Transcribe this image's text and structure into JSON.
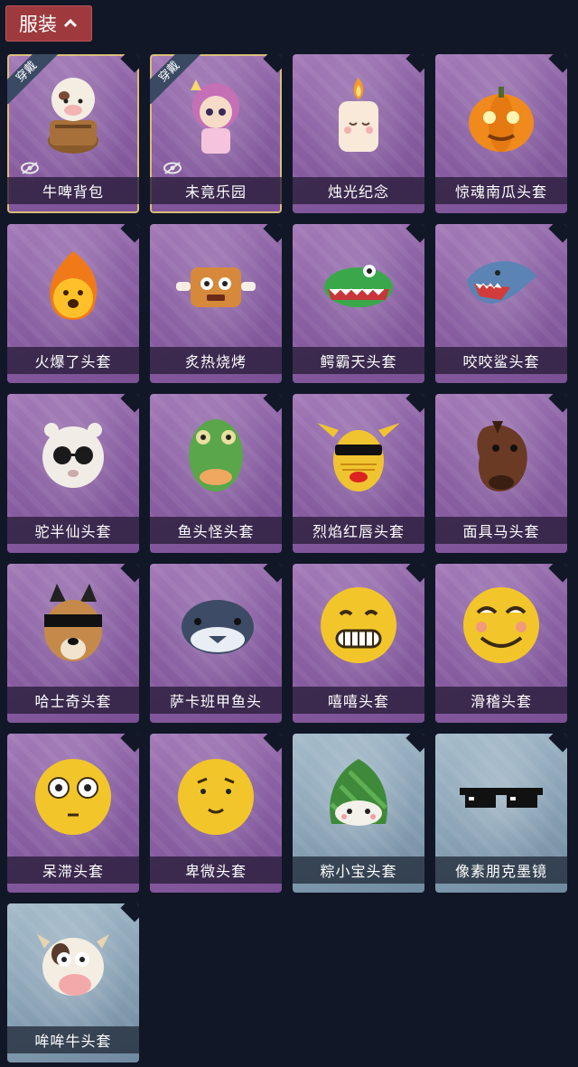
{
  "header": {
    "title": "服装"
  },
  "badge_text": "穿戴",
  "items": [
    {
      "name": "牛啤背包",
      "rarity": "purple",
      "equipped": true,
      "art": "cow-beer"
    },
    {
      "name": "未竟乐园",
      "rarity": "purple",
      "equipped": true,
      "art": "girl"
    },
    {
      "name": "烛光纪念",
      "rarity": "purple",
      "equipped": false,
      "art": "candle"
    },
    {
      "name": "惊魂南瓜头套",
      "rarity": "purple",
      "equipped": false,
      "art": "pumpkin"
    },
    {
      "name": "火爆了头套",
      "rarity": "purple",
      "equipped": false,
      "art": "fire"
    },
    {
      "name": "炙热烧烤",
      "rarity": "purple",
      "equipped": false,
      "art": "bbq"
    },
    {
      "name": "鳄霸天头套",
      "rarity": "purple",
      "equipped": false,
      "art": "croc"
    },
    {
      "name": "咬咬鲨头套",
      "rarity": "purple",
      "equipped": false,
      "art": "shark"
    },
    {
      "name": "驼半仙头套",
      "rarity": "purple",
      "equipped": false,
      "art": "alpaca"
    },
    {
      "name": "鱼头怪头套",
      "rarity": "purple",
      "equipped": false,
      "art": "fishhead"
    },
    {
      "name": "烈焰红唇头套",
      "rarity": "purple",
      "equipped": false,
      "art": "pika"
    },
    {
      "name": "面具马头套",
      "rarity": "purple",
      "equipped": false,
      "art": "horse"
    },
    {
      "name": "哈士奇头套",
      "rarity": "purple",
      "equipped": false,
      "art": "husky"
    },
    {
      "name": "萨卡班甲鱼头",
      "rarity": "purple",
      "equipped": false,
      "art": "fish"
    },
    {
      "name": "嘻嘻头套",
      "rarity": "purple",
      "equipped": false,
      "art": "grin"
    },
    {
      "name": "滑稽头套",
      "rarity": "purple",
      "equipped": false,
      "art": "huaji"
    },
    {
      "name": "呆滞头套",
      "rarity": "purple",
      "equipped": false,
      "art": "stare"
    },
    {
      "name": "卑微头套",
      "rarity": "purple",
      "equipped": false,
      "art": "humble"
    },
    {
      "name": "粽小宝头套",
      "rarity": "blue",
      "equipped": false,
      "art": "zongzi"
    },
    {
      "name": "像素朋克墨镜",
      "rarity": "blue",
      "equipped": false,
      "art": "glasses"
    },
    {
      "name": "哞哞牛头套",
      "rarity": "blue",
      "equipped": false,
      "art": "cow"
    }
  ]
}
